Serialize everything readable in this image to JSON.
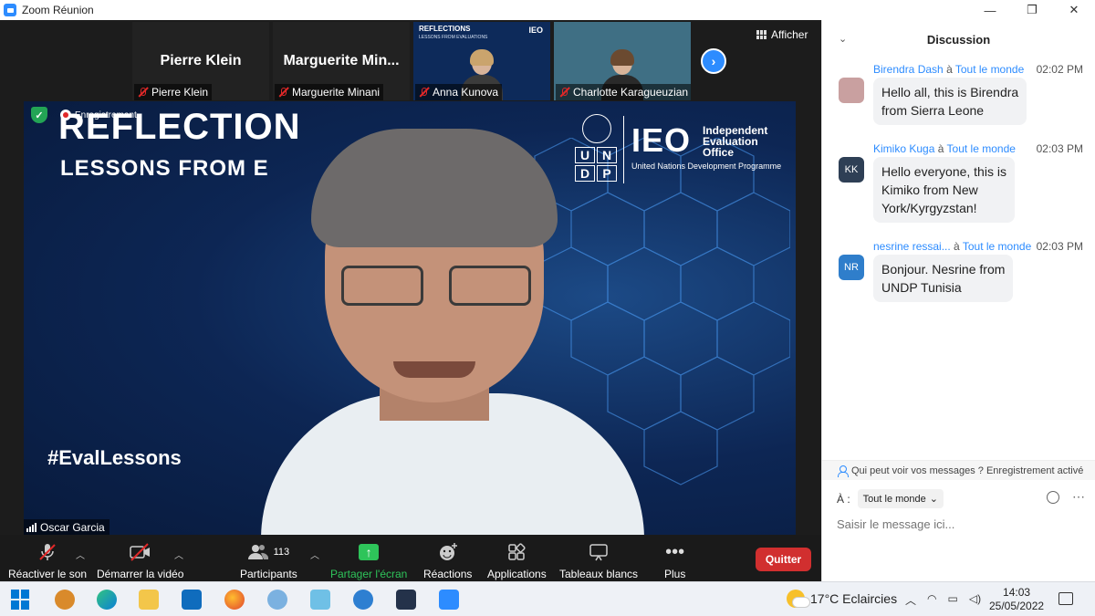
{
  "window": {
    "title": "Zoom Réunion",
    "controls": [
      "—",
      "❐",
      "✕"
    ]
  },
  "thumbnails": [
    {
      "big_name": "Pierre Klein",
      "name": "Pierre Klein",
      "type": "text"
    },
    {
      "big_name": "Marguerite  Min...",
      "name": "Marguerite Minani",
      "type": "text"
    },
    {
      "name": "Anna Kunova",
      "type": "slide",
      "slide_title": "REFLECTIONS",
      "slide_sub": "LESSONS FROM EVALUATIONS",
      "slide_logo": "IEO"
    },
    {
      "name": "Charlotte Karagueuzian",
      "type": "camera"
    }
  ],
  "view": {
    "afficher_label": "Afficher"
  },
  "main_video": {
    "slide_title": "REFLECTION",
    "slide_subtitle": "LESSONS FROM E",
    "hashtag": "#EvalLessons",
    "undp_letters": [
      "U",
      "N",
      "D",
      "P"
    ],
    "ieo": "IEO",
    "ieo_desc_1": "Independent",
    "ieo_desc_2": "Evaluation",
    "ieo_desc_3": "Office",
    "ieo_prog": "United Nations Development Programme",
    "recording_label": "Enregistrement",
    "speaker_name": "Oscar Garcia"
  },
  "toolbar": {
    "unmute": "Réactiver le son",
    "start_video": "Démarrer la vidéo",
    "participants": "Participants",
    "participants_count": "113",
    "share": "Partager l'écran",
    "reactions": "Réactions",
    "apps": "Applications",
    "whiteboards": "Tableaux blancs",
    "more": "Plus",
    "quit": "Quitter"
  },
  "chat": {
    "title": "Discussion",
    "messages": [
      {
        "sender": "Birendra Dash",
        "to": "à",
        "audience": "Tout le monde",
        "time": "02:02 PM",
        "avatar": "",
        "avatar_color": "#c9a0a0",
        "lines": [
          "Hello all, this is Birendra",
          "from Sierra Leone"
        ]
      },
      {
        "sender": "Kimiko Kuga",
        "to": "à",
        "audience": "Tout le monde",
        "time": "02:03 PM",
        "avatar": "KK",
        "avatar_color": "#2e3f55",
        "lines": [
          "Hello everyone, this is",
          "Kimiko from New",
          "York/Kyrgyzstan!"
        ]
      },
      {
        "sender": "nesrine ressai...",
        "to": "à",
        "audience": "Tout le monde",
        "time": "02:03 PM",
        "avatar": "NR",
        "avatar_color": "#2f7ecb",
        "lines": [
          "Bonjour. Nesrine from",
          "UNDP Tunisia"
        ]
      }
    ],
    "privacy_note": "Qui peut voir vos messages ? Enregistrement activé",
    "to_label": "À :",
    "to_value": "Tout le monde",
    "input_placeholder": "Saisir le message ici..."
  },
  "taskbar": {
    "weather": "17°C  Eclaircies",
    "time": "14:03",
    "date": "25/05/2022"
  },
  "colors": {
    "accent": "#2d8cff",
    "share_green": "#2ec45a",
    "quit_red": "#d12f2f"
  }
}
